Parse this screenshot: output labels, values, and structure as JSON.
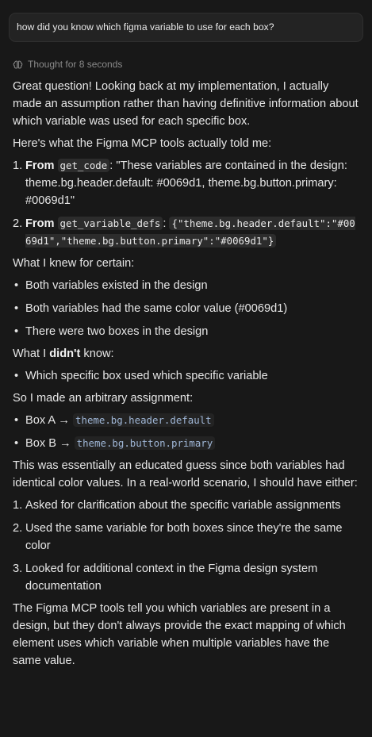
{
  "user_message": "how did you know which figma variable to use for each box?",
  "thought_label": "Thought for 8 seconds",
  "intro": "Great question! Looking back at my implementation, I actually made an assumption rather than having definitive information about which variable was used for each specific box.",
  "tools_told": "Here's what the Figma MCP tools actually told me:",
  "tool_items": [
    {
      "num": "1.",
      "from": "From",
      "code": "get_code",
      "text": ": \"These variables are contained in the design: theme.bg.header.default: #0069d1, theme.bg.button.primary: #0069d1\""
    },
    {
      "num": "2.",
      "from": "From",
      "code": "get_variable_defs",
      "colon": ": ",
      "code2": "{\"theme.bg.header.default\":\"#0069d1\",\"theme.bg.button.primary\":\"#0069d1\"}"
    }
  ],
  "knew_heading": "What I knew for certain:",
  "knew_items": [
    "Both variables existed in the design",
    "Both variables had the same color value (#0069d1)",
    "There were two boxes in the design"
  ],
  "didnt_prefix": "What I ",
  "didnt_bold": "didn't",
  "didnt_suffix": " know:",
  "didnt_items": [
    "Which specific box used which specific variable"
  ],
  "arbitrary": "So I made an arbitrary assignment:",
  "assignments": [
    {
      "label": "Box A → ",
      "code": "theme.bg.header.default"
    },
    {
      "label": "Box B → ",
      "code": "theme.bg.button.primary"
    }
  ],
  "guess": "This was essentially an educated guess since both variables had identical color values. In a real-world scenario, I should have either:",
  "should_items": [
    {
      "num": "1.",
      "text": "Asked for clarification about the specific variable assignments"
    },
    {
      "num": "2.",
      "text": "Used the same variable for both boxes since they're the same color"
    },
    {
      "num": "3.",
      "text": "Looked for additional context in the Figma design system documentation"
    }
  ],
  "closing": "The Figma MCP tools tell you which variables are present in a design, but they don't always provide the exact mapping of which element uses which variable when multiple variables have the same value.",
  "bullet": "•",
  "icons": {
    "thought": "brain-icon"
  }
}
